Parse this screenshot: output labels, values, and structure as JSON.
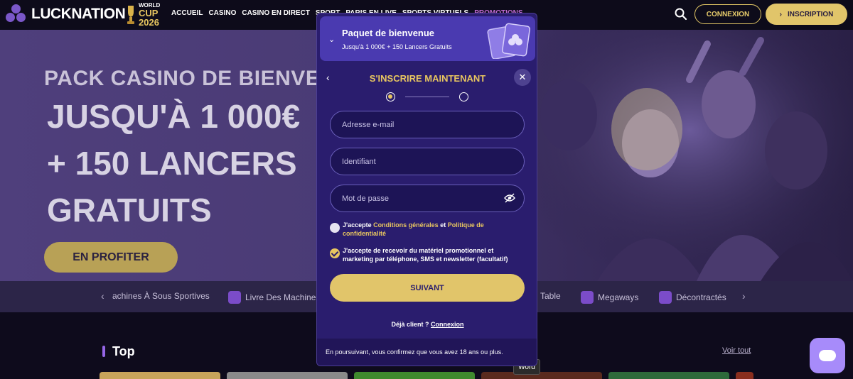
{
  "header": {
    "logo_text": "LUCKNATION",
    "world_cup": {
      "line1": "WORLD",
      "line2": "CUP",
      "line3": "2026"
    },
    "nav": [
      "ACCUEIL",
      "CASINO",
      "CASINO EN DIRECT",
      "SPORT",
      "PARIS EN LIVE",
      "SPORTS VIRTUELS",
      "PROMOTIONS"
    ],
    "connexion_label": "CONNEXION",
    "inscription_label": "INSCRIPTION"
  },
  "hero": {
    "subtitle": "PACK CASINO DE BIENVENUE",
    "line1": "JUSQU'À 1 000€",
    "line2": "+ 150 LANCERS",
    "line3": "GRATUITS",
    "cta": "EN PROFITER"
  },
  "categories": {
    "items": [
      "achines À Sous Sportives",
      "Livre Des Machines",
      "Table",
      "Megaways",
      "Décontractés"
    ]
  },
  "section": {
    "title": "Top",
    "see_all": "Voir tout"
  },
  "modal": {
    "bonus_title": "Paquet de bienvenue",
    "bonus_subtitle": "Jusqu'à 1 000€ + 150 Lancers Gratuits",
    "title": "S'INSCRIRE MAINTENANT",
    "steps": {
      "current": 1,
      "total": 2
    },
    "email_placeholder": "Adresse e-mail",
    "username_placeholder": "Identifiant",
    "password_placeholder": "Mot de passe",
    "terms": {
      "prefix": "J'accepte ",
      "link1": "Conditions générales",
      "mid": " et ",
      "link2": "Politique de confidentialité",
      "checked": false
    },
    "marketing": {
      "text": "J'accepte de recevoir du matériel promotionnel et marketing par téléphone, SMS et newsletter (facultatif)",
      "checked": true
    },
    "next_label": "SUIVANT",
    "already_client": "Déjà client ?",
    "login_link": "Connexion",
    "footer_note": "En poursuivant, vous confirmez que vous avez 18 ans ou plus."
  },
  "tooltip": "Word",
  "colors": {
    "gold": "#e1c56a",
    "modal_bg": "#2a1d6e",
    "accent_purple": "#a78bfa"
  }
}
